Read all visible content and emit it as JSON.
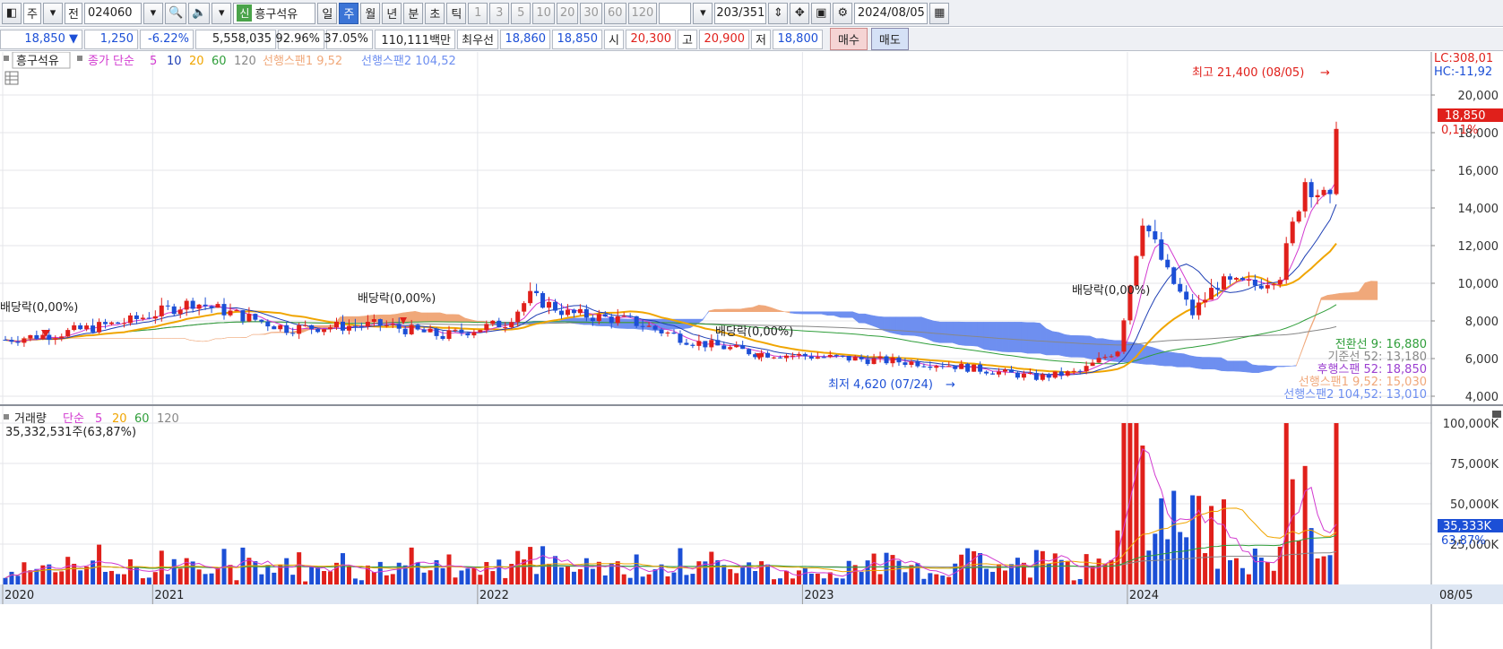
{
  "toolbar": {
    "market": "주",
    "scope": "전",
    "code": "024060",
    "new_badge": "신",
    "name": "흥구석유",
    "periods": [
      "일",
      "주",
      "월",
      "년",
      "분",
      "초",
      "틱"
    ],
    "active_period": "주",
    "intervals": [
      "1",
      "3",
      "5",
      "10",
      "20",
      "30",
      "60",
      "120"
    ],
    "count": "203",
    "total": "/351",
    "date": "2024/08/05"
  },
  "quote": {
    "price": "18,850",
    "change": "1,250",
    "change_pct": "-6.22%",
    "volume": "5,558,035",
    "ratio1": "92.96%",
    "ratio2": "37.05%",
    "amount": "110,111백만",
    "best_label": "최우선",
    "ask": "18,860",
    "bid": "18,850",
    "open_label": "시",
    "open": "20,300",
    "high_label": "고",
    "high": "20,900",
    "low_label": "저",
    "low": "18,800",
    "buy": "매수",
    "sell": "매도"
  },
  "price_legend": {
    "name": "흥구석유",
    "ma_label": "종가 단순",
    "ma5": "5",
    "ma10": "10",
    "ma20": "20",
    "ma60": "60",
    "ma120": "120",
    "span1": "선행스팬1 9,52",
    "span2": "선행스팬2 104,52"
  },
  "price_axis": {
    "ticks": [
      "20,000",
      "18,000",
      "16,000",
      "14,000",
      "12,000",
      "10,000",
      "8,000",
      "6,000",
      "4,000"
    ],
    "lc": "LC:308,01",
    "hc": "HC:-11,92",
    "cur": "18,850",
    "cur_pct": "0,11%"
  },
  "annotations": {
    "high": "최고 21,400 (08/05)",
    "low": "최저 4,620 (07/24)",
    "div1": "배당락(0,00%)",
    "div2": "배당락(0,00%)",
    "div3": "배당락(0,00%)",
    "div4": "배당락(0,00%)"
  },
  "ichimoku_values": {
    "conv": "전환선 9: 16,880",
    "base": "기준선 52: 13,180",
    "lag": "후행스팬 52: 18,850",
    "span1": "선행스팬1 9,52: 15,030",
    "span2": "선행스팬2 104,52: 13,010"
  },
  "volume_legend": {
    "title": "거래량",
    "ma_label": "단순",
    "ma5": "5",
    "ma20": "20",
    "ma60": "60",
    "ma120": "120",
    "value": "35,332,531주(63,87%)"
  },
  "volume_axis": {
    "ticks": [
      "100,000K",
      "75,000K",
      "50,000K",
      "25,000K"
    ],
    "cur": "35,333K",
    "cur_pct": "63,87%"
  },
  "x_axis": {
    "labels": [
      "2020",
      "2021",
      "2022",
      "2023",
      "2024"
    ],
    "right": "08/05"
  },
  "colors": {
    "up": "#e0201b",
    "down": "#1c4fd6",
    "ma5": "#d23bd0",
    "ma10": "#1e3fb4",
    "ma20": "#f0a500",
    "ma60": "#2f9e3a",
    "ma120": "#888888",
    "span1": "#f0a87a",
    "span2": "#6e8ff0"
  }
}
